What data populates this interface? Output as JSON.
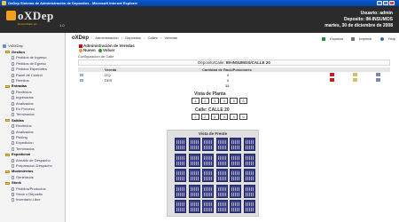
{
  "window": {
    "title": "OxDep Sistema de Administración de Depositos - Microsoft Internet Explorer"
  },
  "header": {
    "logo_text": "oXDep",
    "tagline": "Desarrollado por ...",
    "version": "1.0",
    "user_label": "Usuario: admin",
    "deposit_label": "Deposito: IM-INSUMOS",
    "date": "martes, 30 de diciembre de 2008"
  },
  "sidebar": {
    "top_link": "...",
    "root": "VIOXDep",
    "sections": [
      {
        "label": "Gestion",
        "items": [
          "Pedidos de Ingreso",
          "Pedidos de Egreso",
          "Pedidos Especiales",
          "Panel de Control",
          "Remitos"
        ]
      },
      {
        "label": "Entradas",
        "items": [
          "Recibidos",
          "Ingresados",
          "Analizados",
          "En Proceso",
          "Terminados"
        ]
      },
      {
        "label": "Salidas",
        "items": [
          "Recibidos",
          "Analizados",
          "Picking",
          "Expedicion",
          "Terminados"
        ]
      },
      {
        "label": "Expedicion",
        "items": [
          "Armado de Despacho",
          "Preparacion Despacho"
        ]
      },
      {
        "label": "Movimientos",
        "items": [
          "Generados"
        ]
      },
      {
        "label": "Stock",
        "items": [
          "Pedidos/Productos",
          "Stock x Deposito",
          "Inventario Libre"
        ]
      }
    ]
  },
  "breadcrumb": {
    "brand": "oXDep",
    "items": [
      "Administracion",
      "Depositos",
      "Calles",
      "Veredas"
    ]
  },
  "toplinks": {
    "export": "Exportar",
    "print": "Imprimir",
    "help": "Help"
  },
  "page": {
    "title": "Administración de Veredas",
    "new_label": "Nuevo",
    "back_label": "Volver",
    "subtitle": "Configuracion de Calle",
    "deposit_label": "Deposito/Calle:",
    "deposit_value": "IM-INSUMOS/CALLE 20"
  },
  "grid": {
    "columns": [
      "Vereda",
      "Cantidad de Rack/Posiciones"
    ],
    "rows": [
      {
        "vereda": "IZQ",
        "cantidad": "6"
      },
      {
        "vereda": "DER",
        "cantidad": "6"
      }
    ],
    "total": "12"
  },
  "planta": {
    "title": "Vista de Planta",
    "boxes": [
      "1",
      "2",
      "3",
      "4",
      "5",
      "6"
    ]
  },
  "calle": {
    "title": "Calle: CALLE 20",
    "boxes": [
      "1",
      "2",
      "3",
      "4",
      "5",
      "6"
    ]
  },
  "frente": {
    "title": "Vista de Frente",
    "rows": 5,
    "cols": 6
  }
}
